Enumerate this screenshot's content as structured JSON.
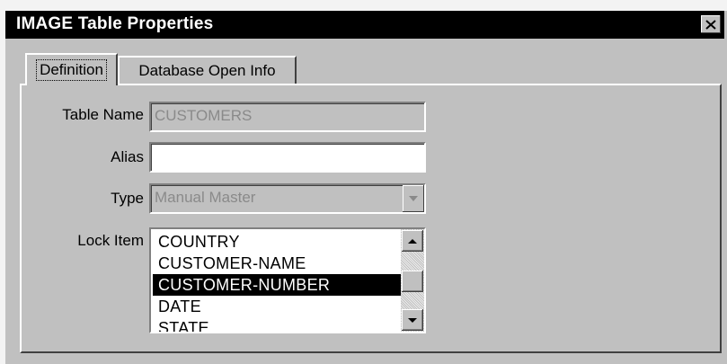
{
  "window": {
    "title": "IMAGE Table Properties",
    "close_symbol": "×"
  },
  "tabs": [
    {
      "label": "Definition",
      "active": true
    },
    {
      "label": "Database Open Info",
      "active": false
    }
  ],
  "form": {
    "table_name": {
      "label": "Table Name",
      "value": "CUSTOMERS",
      "enabled": false
    },
    "alias": {
      "label": "Alias",
      "value": ""
    },
    "type": {
      "label": "Type",
      "value": "Manual Master",
      "enabled": false
    },
    "lock_item": {
      "label": "Lock Item",
      "items": [
        "COUNTRY",
        "CUSTOMER-NAME",
        "CUSTOMER-NUMBER",
        "DATE",
        "STATE"
      ],
      "selected_index": 2
    }
  },
  "icons": {
    "close": "close-icon",
    "dropdown": "chevron-down-icon",
    "scroll_up": "scroll-up-arrow-icon",
    "scroll_down": "scroll-down-arrow-icon"
  },
  "colors": {
    "face": "#c0c0c0",
    "titlebar": "#000000",
    "selection": "#000000",
    "disabled_text": "#8a8a8a"
  }
}
